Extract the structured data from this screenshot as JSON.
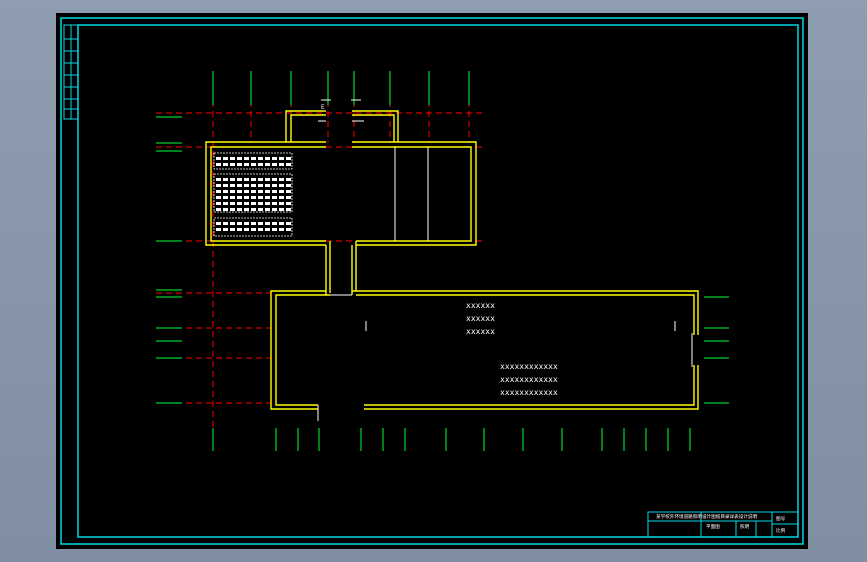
{
  "app": {
    "background_color": "#8796a8",
    "viewport_color": "#000000"
  },
  "colors": {
    "frame": "#00d7e6",
    "wall": "#ffff00",
    "axis": "#ff0000",
    "grid_tick": "#00ff33",
    "text": "#ffffff"
  },
  "title_block": {
    "header_text": "某学校外环境道路照明设计图纸目录详表设计说明",
    "subtext_1": "平面图",
    "subtext_2": "照明",
    "subtext_3": "图号",
    "subtext_4": "比例"
  },
  "drawing": {
    "room_labels": [
      "xxxxxx",
      "xxxxxx",
      "xxxxxx",
      "xxxxxxxxxxxx",
      "xxxxxxxxxxxx",
      "xxxxxxxxxxxx"
    ],
    "small_mark": "E"
  },
  "side_strip_labels": [
    "",
    "",
    "",
    "",
    "",
    ""
  ]
}
